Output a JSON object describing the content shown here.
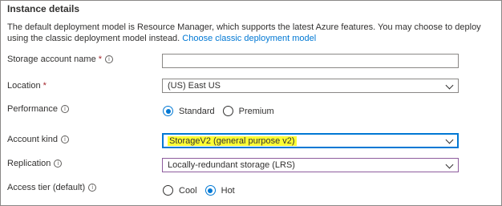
{
  "section": {
    "title": "Instance details"
  },
  "description": {
    "text": "The default deployment model is Resource Manager, which supports the latest Azure features. You may choose to deploy using the classic deployment model instead.",
    "link": "Choose classic deployment model"
  },
  "fields": {
    "storage_account_name": {
      "label": "Storage account name",
      "required": "*",
      "value": ""
    },
    "location": {
      "label": "Location",
      "required": "*",
      "value": "(US) East US"
    },
    "performance": {
      "label": "Performance",
      "options": [
        "Standard",
        "Premium"
      ],
      "selected": "Standard"
    },
    "account_kind": {
      "label": "Account kind",
      "value": "StorageV2 (general purpose v2)"
    },
    "replication": {
      "label": "Replication",
      "value": "Locally-redundant storage (LRS)"
    },
    "access_tier": {
      "label": "Access tier (default)",
      "options": [
        "Cool",
        "Hot"
      ],
      "selected": "Hot"
    }
  },
  "colors": {
    "accent": "#0078d4",
    "required": "#a4262c",
    "highlight": "#ffff33",
    "replication_border": "#8e5c9e"
  },
  "icons": {
    "info": "info-circle-icon",
    "dropdown": "chevron-down-icon"
  }
}
